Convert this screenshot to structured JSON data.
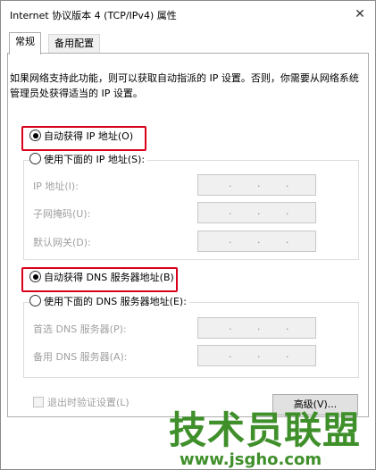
{
  "window": {
    "title": "Internet 协议版本 4 (TCP/IPv4) 属性",
    "close_glyph": "✕"
  },
  "tabs": [
    {
      "label": "常规"
    },
    {
      "label": "备用配置"
    }
  ],
  "description": "如果网络支持此功能，则可以获取自动指派的 IP 设置。否则，你需要从网络系统管理员处获得适当的 IP 设置。",
  "ip_section": {
    "auto_label": "自动获得 IP 地址(O)",
    "manual_label": "使用下面的 IP 地址(S):",
    "fields": [
      {
        "label": "IP 地址(I):",
        "value": ". . ."
      },
      {
        "label": "子网掩码(U):",
        "value": ". . ."
      },
      {
        "label": "默认网关(D):",
        "value": ". . ."
      }
    ]
  },
  "dns_section": {
    "auto_label": "自动获得 DNS 服务器地址(B)",
    "manual_label": "使用下面的 DNS 服务器地址(E):",
    "fields": [
      {
        "label": "首选 DNS 服务器(P):",
        "value": ". . ."
      },
      {
        "label": "备用 DNS 服务器(A):",
        "value": ". . ."
      }
    ]
  },
  "validate_label": "退出时验证设置(L)",
  "advanced_button": "高级(V)...",
  "watermark": {
    "text": "技术员联盟",
    "url": "www.jsgho.com"
  },
  "colors": {
    "highlight_red": "#d9001b",
    "watermark_green": "#3f8f2b"
  }
}
